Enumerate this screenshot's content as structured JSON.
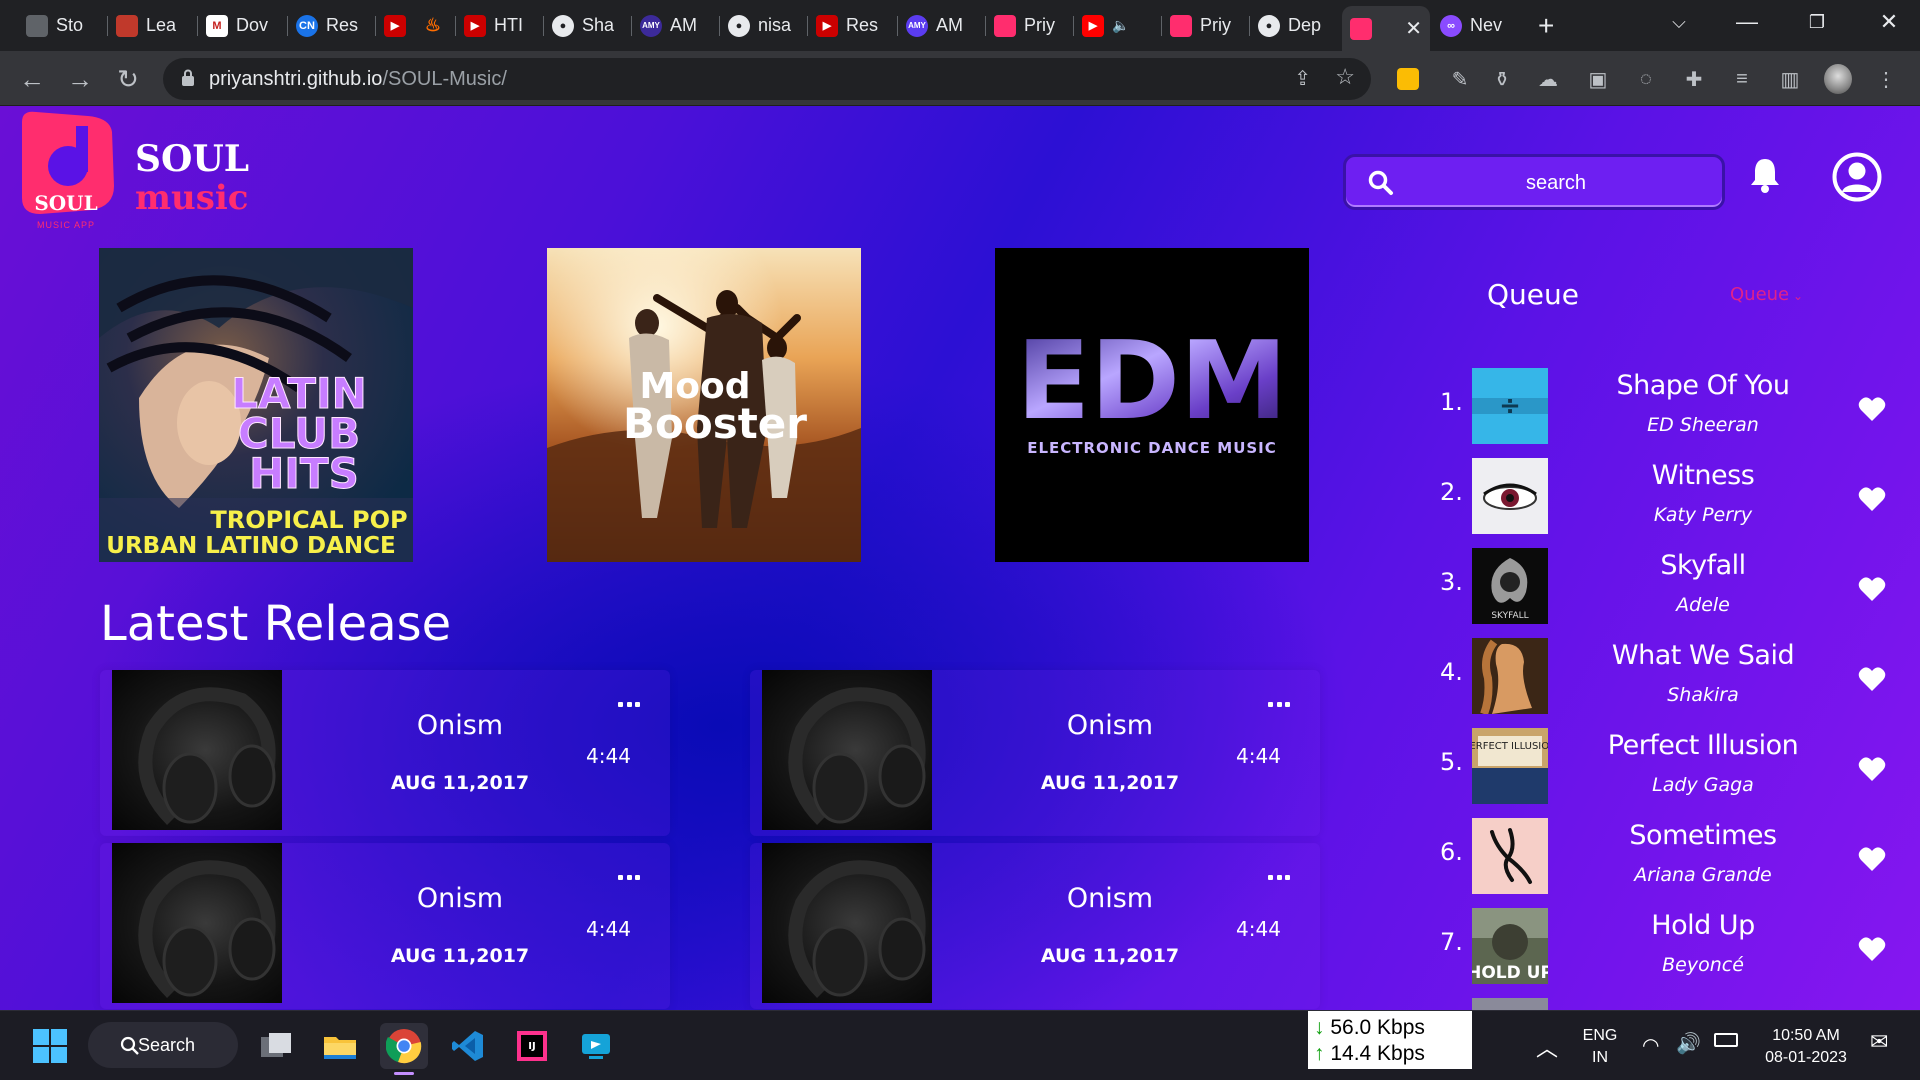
{
  "browser": {
    "tabs": [
      {
        "label": "Sto",
        "icon": "app-icon",
        "color": "#5f6368"
      },
      {
        "label": "Lea",
        "icon": "app-icon",
        "color": "#c0392b"
      },
      {
        "label": "Dov",
        "icon": "gmail-icon",
        "color": "#202124"
      },
      {
        "label": "Res",
        "icon": "cn-icon",
        "color": "#1a73e8"
      },
      {
        "label": "",
        "icon": "youtube-icon",
        "color": "#cc0000"
      },
      {
        "label": "",
        "icon": "fire-icon",
        "color": "#ff6d00"
      },
      {
        "label": "HTI",
        "icon": "youtube-icon",
        "color": "#cc0000"
      },
      {
        "label": "Sha",
        "icon": "github-icon",
        "color": "#202124"
      },
      {
        "label": "AM",
        "icon": "amy-icon",
        "color": "#3c2a9a"
      },
      {
        "label": "nisa",
        "icon": "github-icon",
        "color": "#202124"
      },
      {
        "label": "Res",
        "icon": "youtube-icon",
        "color": "#cc0000"
      },
      {
        "label": "AM",
        "icon": "amy-icon",
        "color": "#5b3cf0"
      },
      {
        "label": "Priy",
        "icon": "soul-icon",
        "color": "#ff2d6e"
      },
      {
        "label": "",
        "icon": "youtube-icon",
        "color": "#ff0000"
      },
      {
        "label": "Priy",
        "icon": "soul-icon",
        "color": "#ff2d6e"
      },
      {
        "label": "Dep",
        "icon": "github-icon",
        "color": "#202124"
      },
      {
        "label": "",
        "icon": "soul-icon",
        "color": "#ff2d6e"
      },
      {
        "label": "Nev",
        "icon": "infinity-icon",
        "color": "#8a4bff"
      }
    ],
    "new_tab": "+",
    "url_host": "priyanshtri.github.io",
    "url_path": "/SOUL-Music/"
  },
  "app": {
    "brand_name": "SOUL",
    "brand_sub": "music",
    "logo_text": "SOUL",
    "logo_subtext": "MUSIC APP",
    "search_placeholder": "search",
    "accent": "#ff2d6e"
  },
  "featured": [
    {
      "title_line1": "LATIN",
      "title_line2": "CLUB",
      "title_line3": "HITS",
      "sub_line1": "TROPICAL POP",
      "sub_line2": "URBAN LATINO DANCE"
    },
    {
      "title_line1": "Mood",
      "title_line2": "Booster"
    },
    {
      "title_line1": "EDM",
      "sub_line1": "ELECTRONIC DANCE MUSIC"
    }
  ],
  "latest": {
    "heading": "Latest Release",
    "items": [
      {
        "title": "Onism",
        "duration": "4:44",
        "date": "AUG 11,2017"
      },
      {
        "title": "Onism",
        "duration": "4:44",
        "date": "AUG 11,2017"
      },
      {
        "title": "Onism",
        "duration": "4:44",
        "date": "AUG 11,2017"
      },
      {
        "title": "Onism",
        "duration": "4:44",
        "date": "AUG 11,2017"
      }
    ]
  },
  "queue": {
    "title": "Queue",
    "selector": "Queue",
    "items": [
      {
        "num": "1.",
        "title": "Shape Of You",
        "artist": "ED Sheeran"
      },
      {
        "num": "2.",
        "title": "Witness",
        "artist": "Katy Perry"
      },
      {
        "num": "3.",
        "title": "Skyfall",
        "artist": "Adele"
      },
      {
        "num": "4.",
        "title": "What We Said",
        "artist": "Shakira"
      },
      {
        "num": "5.",
        "title": "Perfect Illusion",
        "artist": "Lady Gaga"
      },
      {
        "num": "6.",
        "title": "Sometimes",
        "artist": "Ariana Grande"
      },
      {
        "num": "7.",
        "title": "Hold Up",
        "artist": "Beyoncé"
      }
    ],
    "art_text": {
      "shape": "÷",
      "skyfall": "SKYFALL",
      "perfect": "PERFECT ILLUSION",
      "hold": "HOLD UP"
    }
  },
  "taskbar": {
    "search_label": "Search",
    "net_down": "56.0 Kbps",
    "net_up": "14.4 Kbps",
    "lang_line1": "ENG",
    "lang_line2": "IN",
    "time": "10:50 AM",
    "date": "08-01-2023"
  }
}
